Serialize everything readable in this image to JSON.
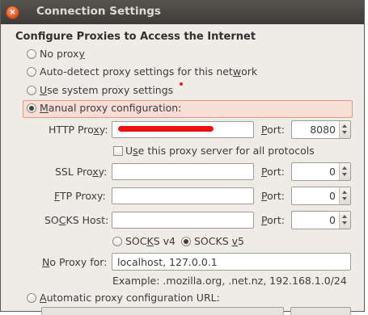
{
  "window": {
    "title": "Connection Settings",
    "close_icon": "close-icon"
  },
  "heading": "Configure Proxies to Access the Internet",
  "options": {
    "no_proxy": {
      "pre": "No prox",
      "u": "y",
      "post": ""
    },
    "auto_detect": {
      "pre": "Auto-detect proxy settings for this net",
      "u": "w",
      "post": "ork"
    },
    "system": {
      "pre": "",
      "u": "U",
      "post": "se system proxy settings"
    },
    "manual": {
      "pre": "",
      "u": "M",
      "post": "anual proxy configuration:"
    },
    "automatic": {
      "pre": "",
      "u": "A",
      "post": "utomatic proxy configuration URL:"
    }
  },
  "http": {
    "label_pre": "HTTP Pro",
    "label_u": "x",
    "label_post": "y:",
    "value": "",
    "port_value": "8080"
  },
  "same_proxy": {
    "pre": "U",
    "u": "s",
    "post": "e this proxy server for all protocols"
  },
  "ssl": {
    "label_pre": "SSL Pro",
    "label_u": "x",
    "label_post": "y:",
    "value": "",
    "port_value": "0"
  },
  "ftp": {
    "label_pre": "",
    "label_u": "F",
    "label_post": "TP Proxy:",
    "value": "",
    "port_value": "0"
  },
  "socks": {
    "label_pre": "SO",
    "label_u": "C",
    "label_post": "KS Host:",
    "value": "",
    "port_value": "0"
  },
  "port": {
    "pre": "",
    "u": "P",
    "post": "ort:"
  },
  "socks_v4": {
    "pre": "SOC",
    "u": "K",
    "post": "S v4"
  },
  "socks_v5": {
    "pre": "SOCKS ",
    "u": "v",
    "post": "5"
  },
  "no_proxy_for": {
    "label_pre": "",
    "label_u": "N",
    "label_post": "o Proxy for:",
    "value": "localhost, 127.0.0.1"
  },
  "example": "Example: .mozilla.org, .net.nz, 192.168.1.0/24",
  "colors": {
    "titlebar": "#3d3c38",
    "highlight": "#f6ddd6",
    "window_bg": "#efebe7",
    "redaction": "#ee1111"
  }
}
